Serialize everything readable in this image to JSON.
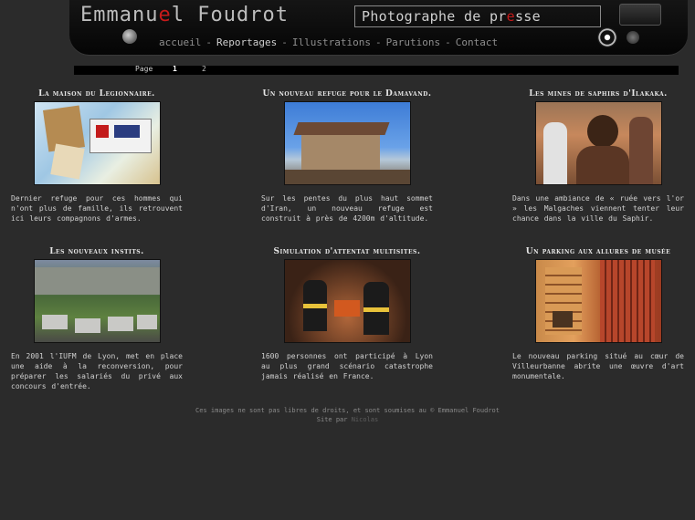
{
  "header": {
    "brand_before": "Emmanu",
    "brand_accent": "e",
    "brand_after": "l Foudrot",
    "tagline_before": "Photographe de pr",
    "tagline_accent": "e",
    "tagline_after": "sse",
    "accent_color": "#c61a1a"
  },
  "nav": {
    "items": [
      "accueil",
      "Reportages",
      "Illustrations",
      "Parutions",
      "Contact"
    ],
    "separator": "-",
    "active": "Reportages"
  },
  "pager": {
    "label": "Page",
    "pages": [
      "1",
      "2"
    ],
    "current": "1"
  },
  "articles": [
    {
      "title": "La maison du Legionnaire.",
      "image": "photo-documents-medals",
      "description": "Dernier refuge pour ces hommes qui n'ont plus de famille, ils retrouvent ici leurs compagnons d'armes."
    },
    {
      "title": "Un nouveau refuge pour le Damavand.",
      "image": "photo-mountain-refuge",
      "description": "Sur les pentes du plus haut sommet d'Iran, un nouveau refuge est construit à près de 4200m d'altitude."
    },
    {
      "title": "Les mines de saphirs d'Ilakaka.",
      "image": "photo-miners-portrait",
      "description": "Dans une ambiance de « ruée vers l'or » les Malgaches viennent tenter leur chance dans la ville du Saphir."
    },
    {
      "title": "Les nouveaux instits.",
      "image": "photo-courtyard-garden",
      "description": "En 2001 l'IUFM de Lyon, met en place une aide à la reconversion, pour préparer les salariés du privé aux concours d'entrée."
    },
    {
      "title": "Simulation d'attentat multisites.",
      "image": "photo-firefighters-exercise",
      "description": "1600 personnes ont participé à Lyon au plus grand scénario catastrophe jamais réalisé en France."
    },
    {
      "title": "Un parking aux allures de musée",
      "image": "photo-parking-artwork",
      "description": "Le nouveau parking situé au cœur de Villeurbanne abrite une œuvre d'art monumentale."
    }
  ],
  "footer": {
    "copyright": "Ces images ne sont pas libres de droits, et sont soumises au © Emmanuel Foudrot",
    "credit_prefix": "Site par",
    "credit_link": "Nicolas"
  }
}
